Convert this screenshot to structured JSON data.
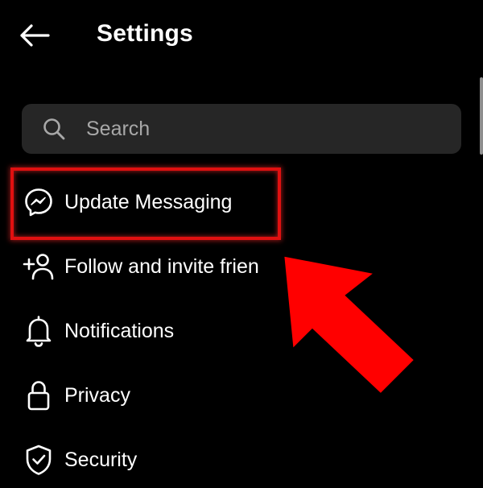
{
  "header": {
    "title": "Settings",
    "back_icon": "arrow-left-icon"
  },
  "search": {
    "placeholder": "Search",
    "value": "",
    "icon": "search-icon"
  },
  "menu": {
    "items": [
      {
        "label": "Update Messaging",
        "icon": "messenger-icon"
      },
      {
        "label": "Follow and invite frien",
        "icon": "add-person-icon"
      },
      {
        "label": "Notifications",
        "icon": "bell-icon"
      },
      {
        "label": "Privacy",
        "icon": "lock-icon"
      },
      {
        "label": "Security",
        "icon": "shield-check-icon"
      }
    ]
  },
  "annotation": {
    "highlight_color": "#e01010",
    "arrow_color": "#ff0000"
  },
  "colors": {
    "background": "#000000",
    "text": "#ffffff",
    "search_bg": "#262626",
    "placeholder": "#a8a8a8"
  }
}
